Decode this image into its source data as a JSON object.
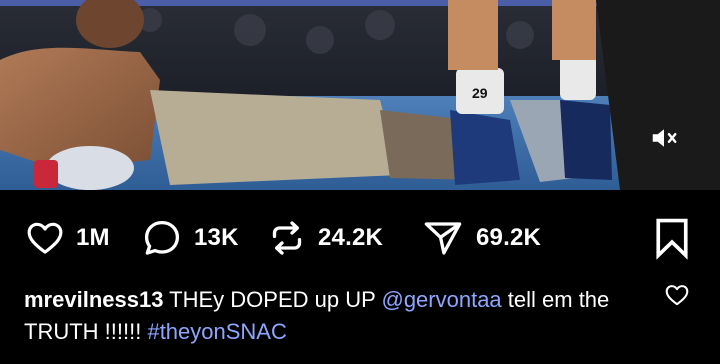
{
  "post": {
    "media": {
      "mute_icon": "speaker-muted-icon",
      "shorts_number": "29"
    },
    "actions": {
      "like_count": "1M",
      "comment_count": "13K",
      "repost_count": "24.2K",
      "share_count": "69.2K"
    },
    "caption": {
      "username": "mrevilness13",
      "text_1": " THEy DOPED up UP ",
      "mention": "@gervontaa",
      "text_2": "  tell em the TRUTH !!!!!! ",
      "hashtag": "#theyonSNAC"
    }
  },
  "colors": {
    "background": "#000000",
    "link": "#8ea6ff",
    "text": "#ffffff"
  }
}
